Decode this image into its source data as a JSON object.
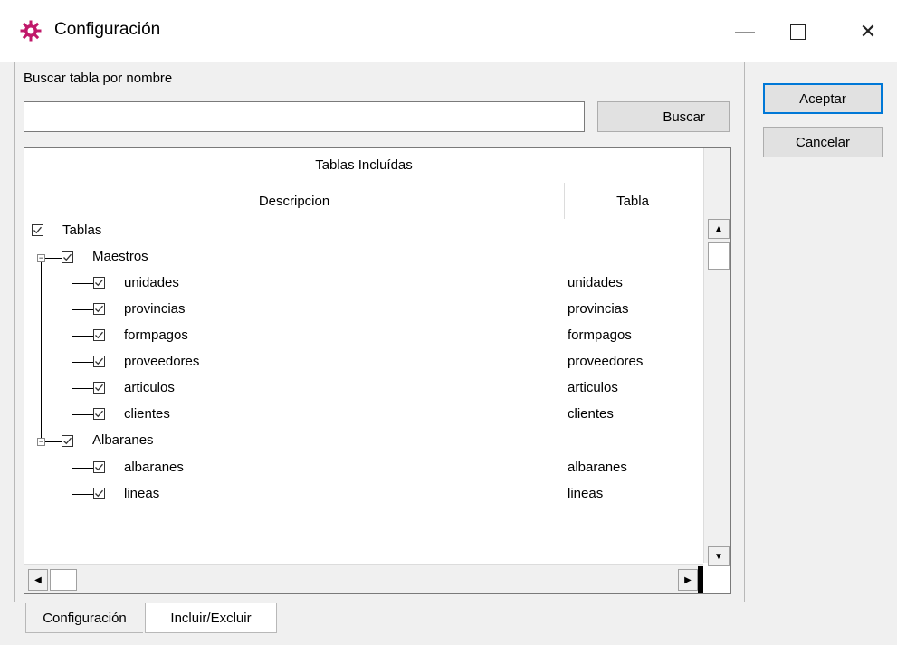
{
  "window": {
    "title": "Configuración",
    "icon": "gear-icon",
    "minimize": "—",
    "close": "✕"
  },
  "search": {
    "label": "Buscar tabla por nombre",
    "value": "",
    "button": "Buscar"
  },
  "actions": {
    "accept": "Aceptar",
    "cancel": "Cancelar"
  },
  "grid": {
    "title": "Tablas Incluídas",
    "columns": [
      "Descripcion",
      "Tabla"
    ],
    "root": {
      "label": "Tablas",
      "checked": true
    },
    "groups": [
      {
        "label": "Maestros",
        "checked": true,
        "items": [
          {
            "label": "unidades",
            "table": "unidades",
            "checked": true
          },
          {
            "label": "provincias",
            "table": "provincias",
            "checked": true
          },
          {
            "label": "formpagos",
            "table": "formpagos",
            "checked": true
          },
          {
            "label": "proveedores",
            "table": "proveedores",
            "checked": true
          },
          {
            "label": "articulos",
            "table": "articulos",
            "checked": true
          },
          {
            "label": "clientes",
            "table": "clientes",
            "checked": true
          }
        ]
      },
      {
        "label": "Albaranes",
        "checked": true,
        "items": [
          {
            "label": "albaranes",
            "table": "albaranes",
            "checked": true
          },
          {
            "label": "lineas",
            "table": "lineas",
            "checked": true
          }
        ]
      }
    ]
  },
  "tabs": [
    {
      "label": "Configuración",
      "active": false
    },
    {
      "label": "Incluir/Excluir",
      "active": true
    }
  ]
}
